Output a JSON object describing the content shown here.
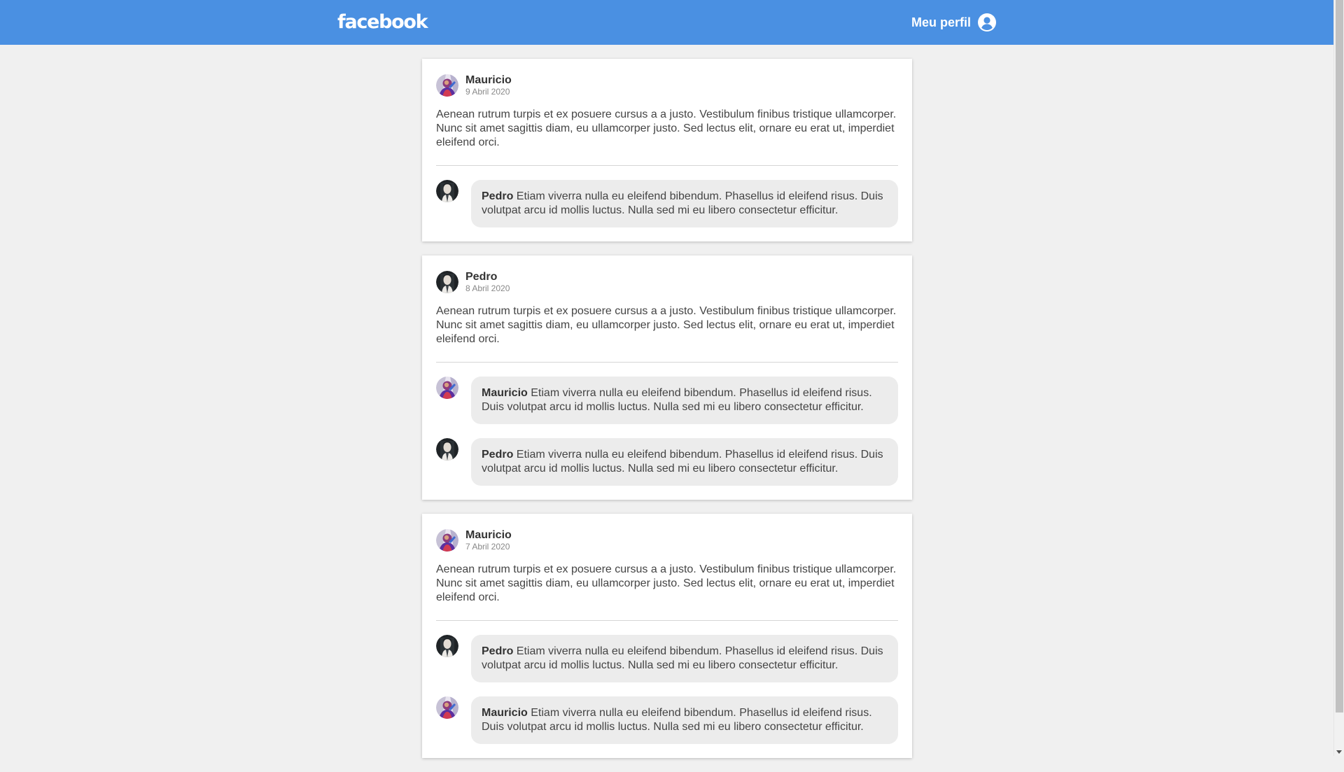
{
  "header": {
    "logo": "facebook",
    "profile_label": "Meu perfil",
    "profile_icon": "user-circle-icon"
  },
  "colors": {
    "topbar": "#4a90e2",
    "card": "#ffffff",
    "background": "#f0f0f0",
    "comment_bubble": "#ececec"
  },
  "posts": [
    {
      "author": "Mauricio",
      "date": "9 Abril 2020",
      "avatar": "avatar-mauricio",
      "text": "Aenean rutrum turpis et ex posuere cursus a a justo. Vestibulum finibus tristique ullamcorper. Nunc sit amet sagittis diam, eu ullamcorper justo. Sed lectus elit, ornare eu erat ut, imperdiet eleifend orci.",
      "comments": [
        {
          "author": "Pedro",
          "avatar": "avatar-pedro",
          "text": "Etiam viverra nulla eu eleifend bibendum. Phasellus id eleifend risus. Duis volutpat arcu id mollis luctus. Nulla sed mi eu libero consectetur efficitur."
        }
      ]
    },
    {
      "author": "Pedro",
      "date": "8 Abril 2020",
      "avatar": "avatar-pedro",
      "text": "Aenean rutrum turpis et ex posuere cursus a a justo. Vestibulum finibus tristique ullamcorper. Nunc sit amet sagittis diam, eu ullamcorper justo. Sed lectus elit, ornare eu erat ut, imperdiet eleifend orci.",
      "comments": [
        {
          "author": "Mauricio",
          "avatar": "avatar-mauricio",
          "text": "Etiam viverra nulla eu eleifend bibendum. Phasellus id eleifend risus. Duis volutpat arcu id mollis luctus. Nulla sed mi eu libero consectetur efficitur."
        },
        {
          "author": "Pedro",
          "avatar": "avatar-pedro",
          "text": "Etiam viverra nulla eu eleifend bibendum. Phasellus id eleifend risus. Duis volutpat arcu id mollis luctus. Nulla sed mi eu libero consectetur efficitur."
        }
      ]
    },
    {
      "author": "Mauricio",
      "date": "7 Abril 2020",
      "avatar": "avatar-mauricio",
      "text": "Aenean rutrum turpis et ex posuere cursus a a justo. Vestibulum finibus tristique ullamcorper. Nunc sit amet sagittis diam, eu ullamcorper justo. Sed lectus elit, ornare eu erat ut, imperdiet eleifend orci.",
      "comments": [
        {
          "author": "Pedro",
          "avatar": "avatar-pedro",
          "text": "Etiam viverra nulla eu eleifend bibendum. Phasellus id eleifend risus. Duis volutpat arcu id mollis luctus. Nulla sed mi eu libero consectetur efficitur."
        },
        {
          "author": "Mauricio",
          "avatar": "avatar-mauricio",
          "text": "Etiam viverra nulla eu eleifend bibendum. Phasellus id eleifend risus. Duis volutpat arcu id mollis luctus. Nulla sed mi eu libero consectetur efficitur."
        }
      ]
    }
  ]
}
